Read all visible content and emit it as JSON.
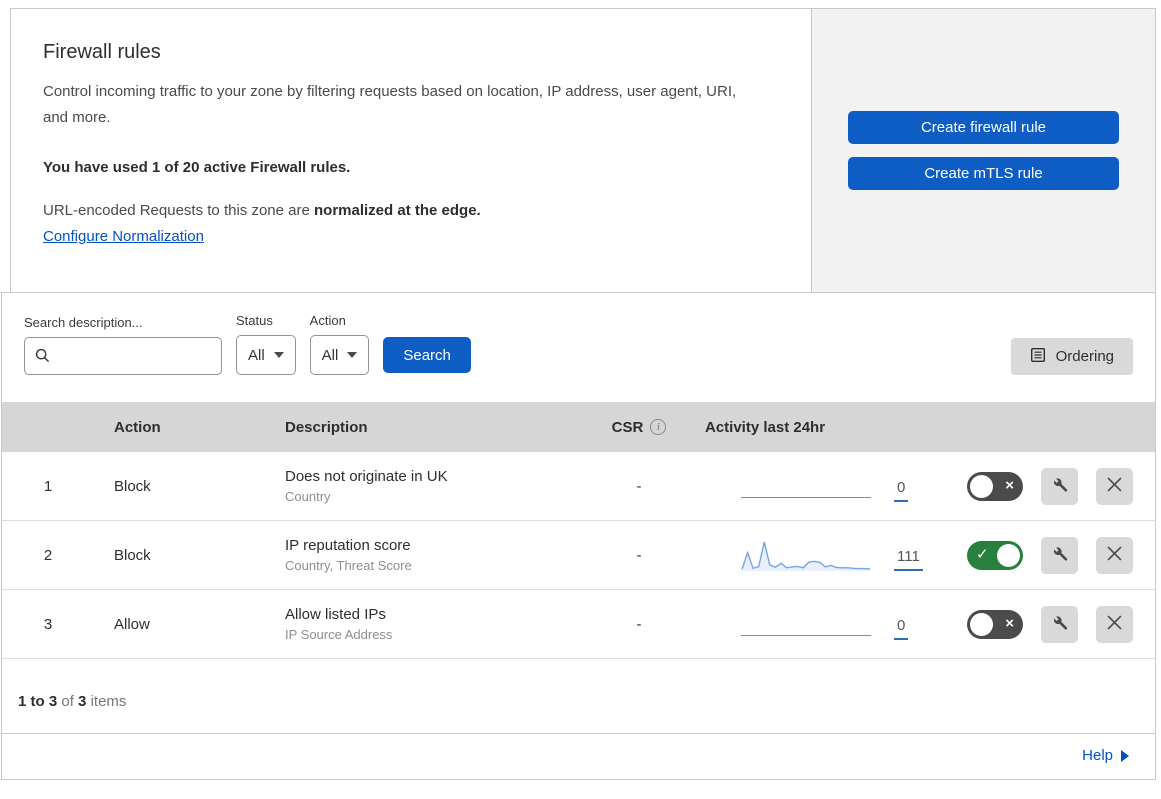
{
  "colors": {
    "primary_button_blue": "#0d5dc5",
    "link_blue": "#0051c3",
    "toggle_on_green": "#297f3d",
    "toggle_off_gray": "#4b4b4b",
    "sparkline_blue": "#74a3ea",
    "table_header_gray": "#d6d6d6",
    "side_panel_gray": "#f2f2f2",
    "secondary_button_gray": "#d9d9d9"
  },
  "header": {
    "title": "Firewall rules",
    "description": "Control incoming traffic to your zone by filtering requests based on location, IP address, user agent, URI, and more.",
    "usage_note": "You have used 1 of 20 active Firewall rules.",
    "normalization_prefix": "URL-encoded Requests to this zone are ",
    "normalization_bold": "normalized at the edge.",
    "normalization_link": "Configure Normalization",
    "create_firewall_rule_label": "Create firewall rule",
    "create_mtls_rule_label": "Create mTLS rule"
  },
  "filters": {
    "search_label": "Search description...",
    "search_value": "",
    "status_label": "Status",
    "status_selected": "All",
    "action_label": "Action",
    "action_selected": "All",
    "search_button_label": "Search",
    "ordering_button_label": "Ordering"
  },
  "table": {
    "headers": {
      "action": "Action",
      "description": "Description",
      "csr": "CSR",
      "activity": "Activity last 24hr"
    },
    "rows": [
      {
        "number": "1",
        "action": "Block",
        "description": "Does not originate in UK",
        "fields": "Country",
        "csr": "-",
        "activity_count": "0",
        "enabled": false
      },
      {
        "number": "2",
        "action": "Block",
        "description": "IP reputation score",
        "fields": "Country, Threat Score",
        "csr": "-",
        "activity_count": "111",
        "enabled": true,
        "sparkline": [
          3,
          62,
          6,
          12,
          100,
          18,
          10,
          24,
          8,
          11,
          13,
          8,
          28,
          31,
          27,
          11,
          16,
          9,
          8,
          8,
          6,
          5,
          5,
          4
        ]
      },
      {
        "number": "3",
        "action": "Allow",
        "description": "Allow listed IPs",
        "fields": "IP Source Address",
        "csr": "-",
        "activity_count": "0",
        "enabled": false
      }
    ]
  },
  "footer": {
    "range": "1 to 3",
    "of_text": "of",
    "total": "3",
    "items_text": "items",
    "help_label": "Help"
  },
  "chart_data": {
    "type": "line",
    "title": "Activity last 24hr sparkline (rule 2: IP reputation score)",
    "values": [
      3,
      62,
      6,
      12,
      100,
      18,
      10,
      24,
      8,
      11,
      13,
      8,
      28,
      31,
      27,
      11,
      16,
      9,
      8,
      8,
      6,
      5,
      5,
      4
    ],
    "total_label": "111"
  }
}
